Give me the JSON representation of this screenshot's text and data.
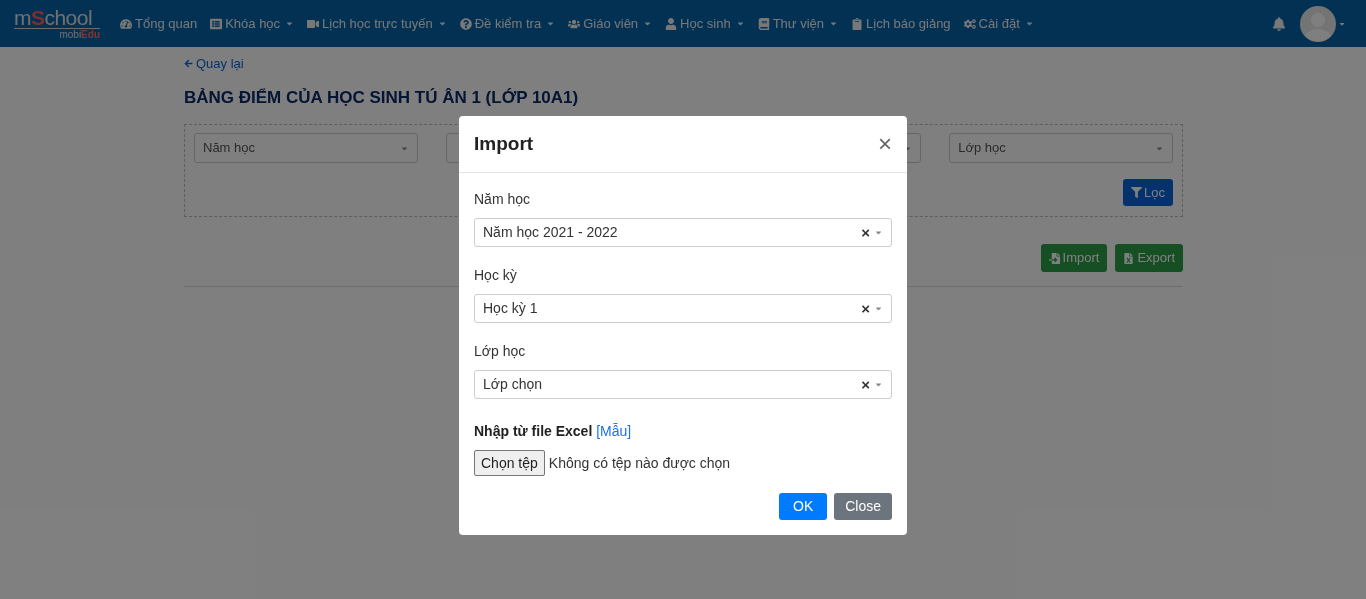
{
  "logo": {
    "name_start": "m",
    "name_mark": "S",
    "name_end": "chool",
    "sub_start": "mobi",
    "sub_end": "Edu"
  },
  "nav": [
    {
      "label": "Tổng quan",
      "dropdown": false
    },
    {
      "label": "Khóa học",
      "dropdown": true
    },
    {
      "label": "Lịch học trực tuyến",
      "dropdown": true
    },
    {
      "label": "Đề kiểm tra",
      "dropdown": true
    },
    {
      "label": "Giáo viên",
      "dropdown": true
    },
    {
      "label": "Học sinh",
      "dropdown": true
    },
    {
      "label": "Thư viện",
      "dropdown": true
    },
    {
      "label": "Lịch báo giảng",
      "dropdown": false
    },
    {
      "label": "Cài đặt",
      "dropdown": true
    }
  ],
  "back_link": "Quay lại",
  "page_title": "BẢNG ĐIỂM CỦA HỌC SINH TÚ ÂN 1 (LỚP 10A1)",
  "filters": [
    {
      "kind": "select",
      "placeholder": "Năm học"
    },
    {
      "kind": "covered"
    },
    {
      "kind": "select"
    },
    {
      "kind": "select",
      "placeholder": "Lớp học"
    }
  ],
  "filter_button": "Lọc",
  "actions": [
    {
      "label": "Import",
      "kind": "import"
    },
    {
      "label": "Export",
      "kind": "export"
    }
  ],
  "modal": {
    "title": "Import",
    "close": "×",
    "fields": [
      {
        "label": "Năm học",
        "value": "Năm học 2021 - 2022",
        "clear": "×"
      },
      {
        "label": "Học kỳ",
        "value": "Học kỳ 1",
        "clear": "×"
      },
      {
        "label": "Lớp học",
        "value": "Lớp chọn",
        "clear": "×"
      }
    ],
    "file_label": "Nhập từ file Excel",
    "template_open": "[",
    "template_link": "Mẫu",
    "template_close": "]",
    "file_button": "Chọn tệp",
    "file_status": "Không có tệp nào được chọn",
    "buttons": [
      {
        "label": "OK",
        "kind": "primary"
      },
      {
        "label": "Close",
        "kind": "secondary"
      }
    ]
  }
}
